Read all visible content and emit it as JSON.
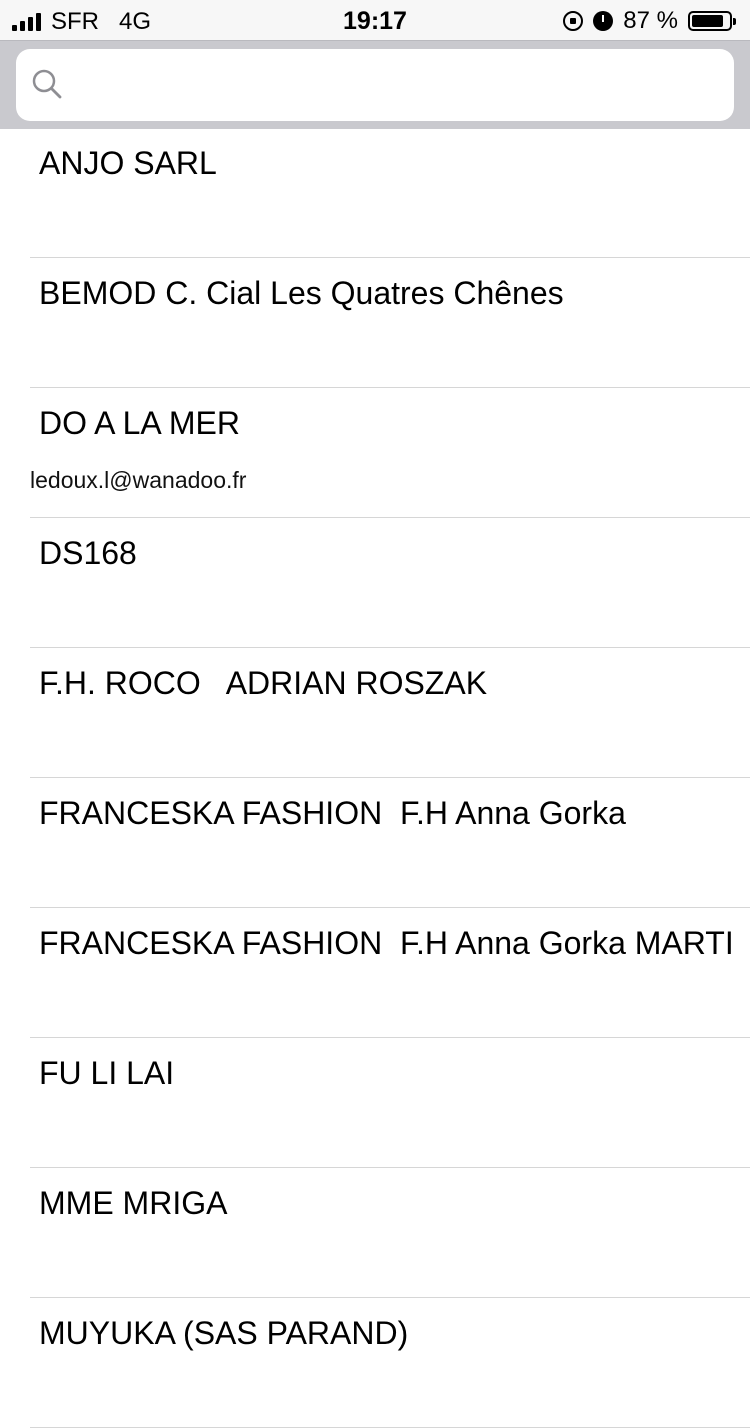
{
  "status_bar": {
    "carrier": "SFR",
    "network": "4G",
    "time": "19:17",
    "battery_text": "87 %",
    "battery_level": 0.87
  },
  "search": {
    "placeholder": "",
    "value": ""
  },
  "contacts": [
    {
      "name": "ANJO SARL",
      "subtitle": ""
    },
    {
      "name": "BEMOD C. Cial Les Quatres Chênes",
      "subtitle": ""
    },
    {
      "name": "DO A LA MER",
      "subtitle": "ledoux.l@wanadoo.fr"
    },
    {
      "name": "DS168",
      "subtitle": ""
    },
    {
      "name": "F.H. ROCO   ADRIAN ROSZAK",
      "subtitle": ""
    },
    {
      "name": "FRANCESKA FASHION  F.H Anna Gorka",
      "subtitle": ""
    },
    {
      "name": "FRANCESKA FASHION  F.H Anna Gorka MARTI",
      "subtitle": ""
    },
    {
      "name": "FU LI LAI",
      "subtitle": ""
    },
    {
      "name": "MME MRIGA",
      "subtitle": ""
    },
    {
      "name": "MUYUKA (SAS PARAND)",
      "subtitle": ""
    }
  ]
}
